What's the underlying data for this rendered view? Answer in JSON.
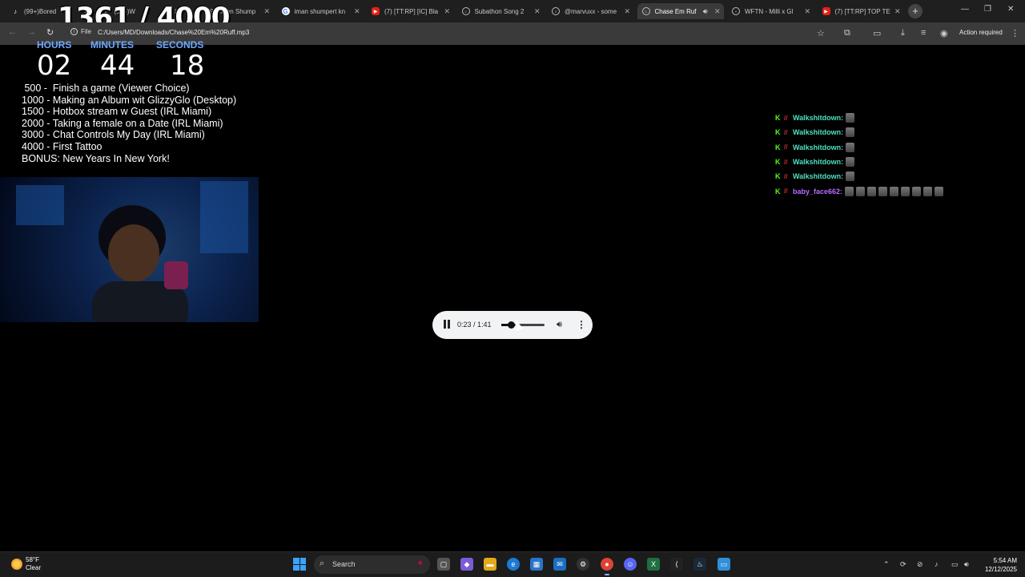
{
  "browser": {
    "tabs": [
      {
        "label": "(99+)Bored",
        "icon": "tiktok-icon",
        "active": false
      },
      {
        "label": "(99+)W",
        "icon": "tiktok-icon",
        "active": false
      },
      {
        "label": "(99+)Iman Shump",
        "icon": "tiktok-icon",
        "active": false
      },
      {
        "label": "iman shumpert kn",
        "icon": "google-icon",
        "active": false
      },
      {
        "label": "(7) [TT:RP] [IC] Bla",
        "icon": "youtube-icon",
        "active": false
      },
      {
        "label": "Subathon Song 2",
        "icon": "globe-icon",
        "active": false
      },
      {
        "label": "@marvuxx - some",
        "icon": "globe-icon",
        "active": false
      },
      {
        "label": "Chase Em Ruf",
        "icon": "globe-icon",
        "active": true
      },
      {
        "label": "WFTN - Milli x Gl",
        "icon": "globe-icon",
        "active": false
      },
      {
        "label": "(7) [TT:RP] TOP TE",
        "icon": "youtube-icon",
        "active": false
      }
    ],
    "file_chip": "File",
    "url": "C:/Users/MD/Downloads/Chase%20Em%20Ruff.mp3",
    "action_required": "Action required"
  },
  "overlay": {
    "counter": "1361 / 4000",
    "timer": {
      "hours_label": "HOURS",
      "minutes_label": "MINUTES",
      "seconds_label": "SECONDS",
      "hours": "02",
      "minutes": "44",
      "seconds": "18"
    },
    "goals": [
      " 500 -  Finish a game (Viewer Choice)",
      "1000 - Making an Album wit GlizzyGlo (Desktop)",
      "1500 - Hotbox stream w Guest (IRL Miami)",
      "2000 - Taking a female on a Date (IRL Miami)",
      "3000 - Chat Controls My Day (IRL Miami)",
      "4000 - First Tattoo",
      "BONUS: New Years In New York!"
    ],
    "chat": [
      {
        "user": "Walkshitdown:",
        "color": "#4fe0c0",
        "emotes": 1
      },
      {
        "user": "Walkshitdown:",
        "color": "#4fe0c0",
        "emotes": 1
      },
      {
        "user": "Walkshitdown:",
        "color": "#4fe0c0",
        "emotes": 1
      },
      {
        "user": "Walkshitdown:",
        "color": "#4fe0c0",
        "emotes": 1
      },
      {
        "user": "Walkshitdown:",
        "color": "#4fe0c0",
        "emotes": 1
      },
      {
        "user": "baby_face662:",
        "color": "#b86cff",
        "emotes": 9
      }
    ]
  },
  "player": {
    "time": "0:23 / 1:41",
    "progress": 0.228
  },
  "taskbar": {
    "weather_temp": "58°F",
    "weather_cond": "Clear",
    "search_label": "Search",
    "time": "5:54 AM",
    "date": "12/12/2025"
  },
  "colors": {
    "timer_label": "#6fa8ff",
    "kick_green": "#53fc18",
    "accent": "#3ba3ff"
  }
}
